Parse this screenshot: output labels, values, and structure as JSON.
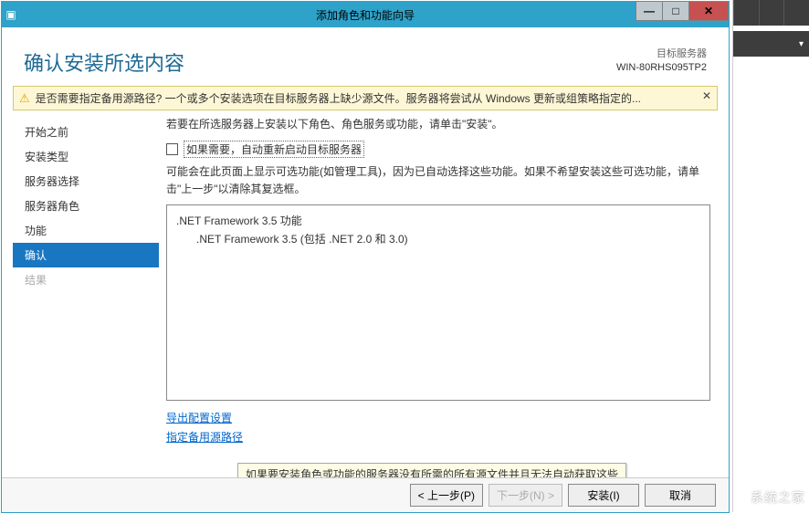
{
  "titlebar": {
    "title": "添加角色和功能向导"
  },
  "header": {
    "heading": "确认安装所选内容",
    "server_label": "目标服务器",
    "server_value": "WIN-80RHS095TP2"
  },
  "warning": {
    "text": "是否需要指定备用源路径? 一个或多个安装选项在目标服务器上缺少源文件。服务器将尝试从 Windows 更新或组策略指定的..."
  },
  "sidebar": {
    "steps": [
      {
        "label": "开始之前"
      },
      {
        "label": "安装类型"
      },
      {
        "label": "服务器选择"
      },
      {
        "label": "服务器角色"
      },
      {
        "label": "功能"
      },
      {
        "label": "确认"
      },
      {
        "label": "结果"
      }
    ]
  },
  "content": {
    "desc1": "若要在所选服务器上安装以下角色、角色服务或功能，请单击\"安装\"。",
    "checkbox_label": "如果需要，自动重新启动目标服务器",
    "desc2": "可能会在此页面上显示可选功能(如管理工具)，因为已自动选择这些功能。如果不希望安装这些可选功能，请单击\"上一步\"以清除其复选框。",
    "features": {
      "f1": ".NET Framework 3.5 功能",
      "f2": ".NET Framework 3.5 (包括 .NET 2.0 和 3.0)"
    },
    "link1": "导出配置设置",
    "link2": "指定备用源路径"
  },
  "tooltip": "如果要安装角色或功能的服务器没有所需的所有源文件并且无法自动获取这些",
  "footer": {
    "prev": "< 上一步(P)",
    "next": "下一步(N) >",
    "install": "安装(I)",
    "cancel": "取消"
  },
  "watermark": "系统之家"
}
